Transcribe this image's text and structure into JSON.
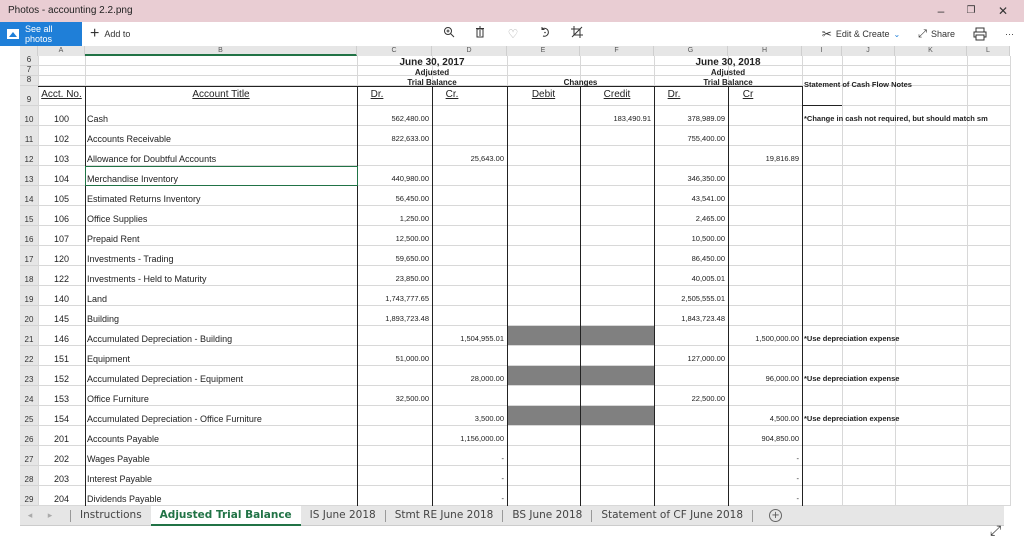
{
  "window": {
    "title": "Photos - accounting 2.2.png",
    "minimize_icon": "minimize-icon",
    "maximize_icon": "restore-icon",
    "close_icon": "close-icon"
  },
  "toolbar": {
    "see_all_label": "See all photos",
    "add_to_label": "Add to",
    "icons": [
      "zoom-in-icon",
      "delete-icon",
      "favorite-heart-icon",
      "rotate-icon",
      "crop-icon"
    ],
    "edit_create_label": "Edit & Create",
    "share_label": "Share",
    "print_icon": "print-icon",
    "more_label": "···"
  },
  "sheet": {
    "columns": [
      "A",
      "B",
      "C",
      "D",
      "E",
      "F",
      "G",
      "H",
      "I",
      "J",
      "K",
      "L"
    ],
    "header": {
      "date_2017": "June 30, 2017",
      "date_2018": "June 30, 2018",
      "adjusted_1": "Adjusted",
      "adjusted_2": "Adjusted",
      "tb_1": "Trial Balance",
      "tb_2": "Trial Balance",
      "changes": "Changes",
      "notes_title": "Statement of Cash Flow Notes",
      "acct_no": "Acct. No.",
      "acct_title": "Account Title",
      "dr_2017": "Dr.",
      "cr_2017": "Cr.",
      "debit": "Debit",
      "credit": "Credit",
      "dr_2018": "Dr.",
      "cr_2018": "Cr"
    },
    "header_row_numbers": [
      "6",
      "7",
      "8",
      "9"
    ],
    "rows": [
      {
        "row": "10",
        "acct": "100",
        "title": "Cash",
        "dr17": "562,480.00",
        "cr17": "",
        "debit": "",
        "credit": "183,490.91",
        "dr18": "378,989.09",
        "cr18": "",
        "note": "*Change in cash not required, but should match sm",
        "shaded": false
      },
      {
        "row": "11",
        "acct": "102",
        "title": "Accounts Receivable",
        "dr17": "822,633.00",
        "cr17": "",
        "debit": "",
        "credit": "",
        "dr18": "755,400.00",
        "cr18": "",
        "note": "",
        "shaded": false
      },
      {
        "row": "12",
        "acct": "103",
        "title": "Allowance for Doubtful Accounts",
        "dr17": "",
        "cr17": "25,643.00",
        "debit": "",
        "credit": "",
        "dr18": "",
        "cr18": "19,816.89",
        "note": "",
        "shaded": false
      },
      {
        "row": "13",
        "acct": "104",
        "title": "Merchandise Inventory",
        "dr17": "440,980.00",
        "cr17": "",
        "debit": "",
        "credit": "",
        "dr18": "346,350.00",
        "cr18": "",
        "note": "",
        "shaded": false
      },
      {
        "row": "14",
        "acct": "105",
        "title": "Estimated Returns Inventory",
        "dr17": "56,450.00",
        "cr17": "",
        "debit": "",
        "credit": "",
        "dr18": "43,541.00",
        "cr18": "",
        "note": "",
        "shaded": false
      },
      {
        "row": "15",
        "acct": "106",
        "title": "Office Supplies",
        "dr17": "1,250.00",
        "cr17": "",
        "debit": "",
        "credit": "",
        "dr18": "2,465.00",
        "cr18": "",
        "note": "",
        "shaded": false
      },
      {
        "row": "16",
        "acct": "107",
        "title": "Prepaid Rent",
        "dr17": "12,500.00",
        "cr17": "",
        "debit": "",
        "credit": "",
        "dr18": "10,500.00",
        "cr18": "",
        "note": "",
        "shaded": false
      },
      {
        "row": "17",
        "acct": "120",
        "title": "Investments - Trading",
        "dr17": "59,650.00",
        "cr17": "",
        "debit": "",
        "credit": "",
        "dr18": "86,450.00",
        "cr18": "",
        "note": "",
        "shaded": false
      },
      {
        "row": "18",
        "acct": "122",
        "title": "Investments - Held to Maturity",
        "dr17": "23,850.00",
        "cr17": "",
        "debit": "",
        "credit": "",
        "dr18": "40,005.01",
        "cr18": "",
        "note": "",
        "shaded": false
      },
      {
        "row": "19",
        "acct": "140",
        "title": "Land",
        "dr17": "1,743,777.65",
        "cr17": "",
        "debit": "",
        "credit": "",
        "dr18": "2,505,555.01",
        "cr18": "",
        "note": "",
        "shaded": false
      },
      {
        "row": "20",
        "acct": "145",
        "title": "Building",
        "dr17": "1,893,723.48",
        "cr17": "",
        "debit": "",
        "credit": "",
        "dr18": "1,843,723.48",
        "cr18": "",
        "note": "",
        "shaded": false
      },
      {
        "row": "21",
        "acct": "146",
        "title": "Accumulated Depreciation - Building",
        "dr17": "",
        "cr17": "1,504,955.01",
        "debit": "",
        "credit": "",
        "dr18": "",
        "cr18": "1,500,000.00",
        "note": "*Use depreciation expense",
        "shaded": true
      },
      {
        "row": "22",
        "acct": "151",
        "title": "Equipment",
        "dr17": "51,000.00",
        "cr17": "",
        "debit": "",
        "credit": "",
        "dr18": "127,000.00",
        "cr18": "",
        "note": "",
        "shaded": false
      },
      {
        "row": "23",
        "acct": "152",
        "title": "Accumulated Depreciation - Equipment",
        "dr17": "",
        "cr17": "28,000.00",
        "debit": "",
        "credit": "",
        "dr18": "",
        "cr18": "96,000.00",
        "note": "*Use depreciation expense",
        "shaded": true
      },
      {
        "row": "24",
        "acct": "153",
        "title": "Office Furniture",
        "dr17": "32,500.00",
        "cr17": "",
        "debit": "",
        "credit": "",
        "dr18": "22,500.00",
        "cr18": "",
        "note": "",
        "shaded": false
      },
      {
        "row": "25",
        "acct": "154",
        "title": "Accumulated Depreciation - Office Furniture",
        "dr17": "",
        "cr17": "3,500.00",
        "debit": "",
        "credit": "",
        "dr18": "",
        "cr18": "4,500.00",
        "note": "*Use depreciation expense",
        "shaded": true
      },
      {
        "row": "26",
        "acct": "201",
        "title": "Accounts Payable",
        "dr17": "",
        "cr17": "1,156,000.00",
        "debit": "",
        "credit": "",
        "dr18": "",
        "cr18": "904,850.00",
        "note": "",
        "shaded": false
      },
      {
        "row": "27",
        "acct": "202",
        "title": "Wages Payable",
        "dr17": "",
        "cr17": "-",
        "debit": "",
        "credit": "",
        "dr18": "",
        "cr18": "-",
        "note": "",
        "shaded": false
      },
      {
        "row": "28",
        "acct": "203",
        "title": "Interest Payable",
        "dr17": "",
        "cr17": "-",
        "debit": "",
        "credit": "",
        "dr18": "",
        "cr18": "-",
        "note": "",
        "shaded": false
      },
      {
        "row": "29",
        "acct": "204",
        "title": "Dividends Payable",
        "dr17": "",
        "cr17": "-",
        "debit": "",
        "credit": "",
        "dr18": "",
        "cr18": "-",
        "note": "",
        "shaded": false
      }
    ],
    "selected_cell": "B13"
  },
  "tabs": [
    {
      "label": "Instructions",
      "active": false
    },
    {
      "label": "Adjusted Trial Balance",
      "active": true
    },
    {
      "label": "IS June 2018",
      "active": false
    },
    {
      "label": "Stmt RE June 2018",
      "active": false
    },
    {
      "label": "BS June 2018",
      "active": false
    },
    {
      "label": "Statement of CF June 2018",
      "active": false
    }
  ],
  "add_sheet_label": "+",
  "nav_prev": "◂",
  "nav_next": "▸",
  "resize_icon": "⤢"
}
